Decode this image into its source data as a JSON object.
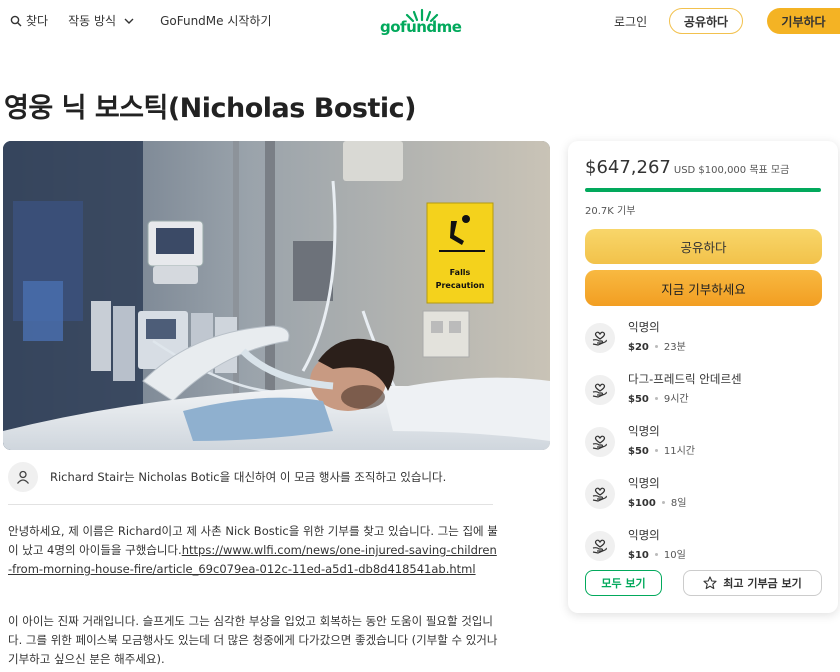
{
  "header": {
    "search_label": "찾다",
    "how_it_works_label": "작동 방식",
    "start_label": "GoFundMe 시작하기",
    "logo_text": "gofundme",
    "login_label": "로그인",
    "share_label": "공유하다",
    "donate_label": "기부하다"
  },
  "campaign": {
    "title": "영웅 닉 보스틱(Nicholas Bostic)",
    "organizer_text": "Richard Stair는 Nicholas Botic을 대신하여 이 모금 행사를 조직하고 있습니다.",
    "story_p1_text": "안녕하세요, 제 이름은 Richard이고 제 사촌 Nick Bostic을 위한 기부를 찾고 있습니다. 그는 집에 불이 났고 4명의 아이들을 구했습니다.",
    "story_p1_link": "https://www.wlfi.com/news/one-injured-saving-children-from-morning-house-fire/article_69c079ea-012c-11ed-a5d1-db8d418541ab.html",
    "story_p2": "이 아이는 진짜 거래입니다. 슬프게도 그는 심각한 부상을 입었고 회복하는 동안 도움이 필요할 것입니다. 그를 위한 페이스북 모금행사도 있는데 더 많은 청중에게 다가갔으면 좋겠습니다 (기부할 수 있거나 기부하고 싶으신 분은 해주세요)."
  },
  "hero_sign": {
    "line1": "Falls",
    "line2": "Precaution"
  },
  "sidebar": {
    "amount": "$647,267",
    "goal_text": "USD $100,000 목표 모금",
    "progress_fraction": 1.0,
    "donations_count": "20.7K 기부",
    "share_button": "공유하다",
    "donate_button": "지금 기부하세요",
    "donors": [
      {
        "name": "익명의",
        "amount": "$20",
        "time": "23분"
      },
      {
        "name": "다그-프레드릭 안데르센",
        "amount": "$50",
        "time": "9시간"
      },
      {
        "name": "익명의",
        "amount": "$50",
        "time": "11시간"
      },
      {
        "name": "익명의",
        "amount": "$100",
        "time": "8일"
      },
      {
        "name": "익명의",
        "amount": "$10",
        "time": "10일"
      }
    ],
    "see_all_label": "모두 보기",
    "see_top_label": "최고 기부금 보기"
  },
  "colors": {
    "brand_green": "#02a95c",
    "share_yellow": "#f2c24a",
    "donate_orange": "#f29e22"
  }
}
